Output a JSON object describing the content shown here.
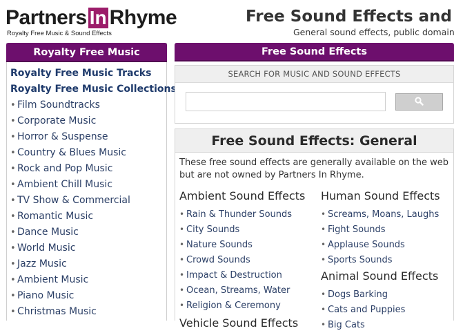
{
  "header": {
    "logo_left": "Partners",
    "logo_box": "In",
    "logo_right": "Rhyme",
    "tagline": "Royalty Free Music & Sound Effects",
    "title": "Free Sound Effects and R",
    "subtitle": "General sound effects, public domain so"
  },
  "sidebar": {
    "heading": "Royalty Free Music",
    "top_links": [
      "Royalty Free Music Tracks",
      "Royalty Free Music Collections"
    ],
    "bullet": "•",
    "items": [
      "Film Soundtracks",
      "Corporate Music",
      "Horror & Suspense",
      "Country & Blues Music",
      "Rock and Pop Music",
      "Ambient Chill Music",
      "TV Show & Commercial",
      "Romantic Music",
      "Dance Music",
      "World Music",
      "Jazz Music",
      "Ambient Music",
      "Piano Music",
      "Christmas Music"
    ]
  },
  "main": {
    "heading": "Free Sound Effects",
    "search": {
      "caption": "SEARCH FOR MUSIC AND SOUND EFFECTS",
      "value": "",
      "placeholder": "",
      "button_icon": "search-icon"
    },
    "content": {
      "title": "Free Sound Effects: General",
      "intro": "These free sound effects are generally available on the web but are not owned by Partners In Rhyme.",
      "left_sections": [
        {
          "heading": "Ambient Sound Effects",
          "items": [
            "Rain & Thunder Sounds",
            "City Sounds",
            "Nature Sounds",
            "Crowd Sounds",
            "Impact & Destruction",
            "Ocean, Streams, Water",
            "Religion & Ceremony"
          ]
        },
        {
          "heading": "Vehicle Sound Effects",
          "items": []
        }
      ],
      "right_sections": [
        {
          "heading": "Human Sound Effects",
          "items": [
            "Screams, Moans, Laughs",
            "Fight Sounds",
            "Applause Sounds",
            "Sports Sounds"
          ]
        },
        {
          "heading": "Animal Sound Effects",
          "items": [
            "Dogs Barking",
            "Cats and Puppies",
            "Big Cats"
          ]
        }
      ]
    }
  },
  "colors": {
    "header_bar": "#6d0f6d",
    "logo_accent": "#9c1d6a",
    "link": "#1e3a6b"
  }
}
